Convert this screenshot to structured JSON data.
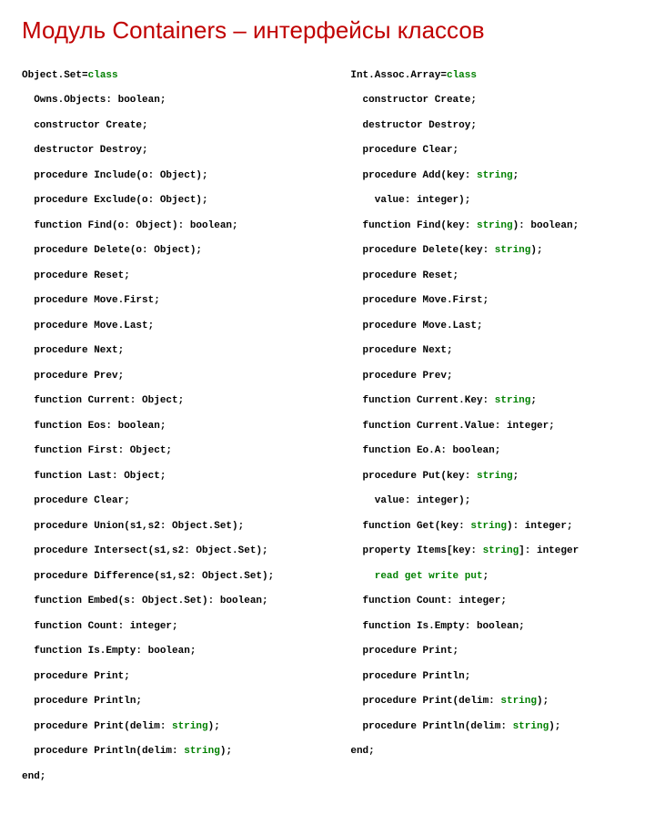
{
  "title": "Модуль Containers – интерфейсы классов",
  "left": {
    "l0a": "Object.Set=",
    "l0b": "class",
    "l1a": "Owns.Objects: ",
    "l1b": "boolean;",
    "l2a": "constructor",
    "l2b": " Create;",
    "l3a": "destructor",
    "l3b": " Destroy;",
    "l4a": "procedure",
    "l4b": " Include(o: Object);",
    "l5a": "procedure",
    "l5b": " Exclude(o: Object);",
    "l6a": "function",
    "l6b": " Find(o: Object): boolean;",
    "l7a": "procedure",
    "l7b": " Delete(o: Object);",
    "l8a": "procedure",
    "l8b": " Reset;",
    "l9a": "procedure",
    "l9b": " Move.First;",
    "l10a": "procedure",
    "l10b": " Move.Last;",
    "l11a": "procedure",
    "l11b": " Next;",
    "l12a": "procedure",
    "l12b": " Prev;",
    "l13a": "function",
    "l13b": " Current: Object;",
    "l14a": "function",
    "l14b": " Eos: boolean;",
    "l15a": "function",
    "l15b": " First: Object;",
    "l16a": "function",
    "l16b": " Last: Object;",
    "l17a": "procedure",
    "l17b": " Clear;",
    "l18a": "procedure",
    "l18b": " Union(s1,s2: Object.Set);",
    "l19a": "procedure",
    "l19b": " Intersect(s1,s2: Object.Set);",
    "l20a": "procedure",
    "l20b": " Difference(s1,s2: Object.Set);",
    "l21a": "function",
    "l21b": " Embed(s: Object.Set): boolean;",
    "l22a": "function",
    "l22b": " Count: integer;",
    "l23a": "function",
    "l23b": " Is.Empty: boolean;",
    "l24a": "procedure",
    "l24b": " Print;",
    "l25a": "procedure",
    "l25b": " Println;",
    "l26a": "procedure",
    "l26b": " Print(delim: ",
    "l26c": "string",
    "l26d": ");",
    "l27a": "procedure",
    "l27b": " Println(delim: ",
    "l27c": "string",
    "l27d": ");",
    "l28": "end;"
  },
  "right": {
    "r0a": "Int.Assoc.Array=",
    "r0b": "class",
    "r1a": "constructor",
    "r1b": " Create;",
    "r2a": "destructor",
    "r2b": " Destroy;",
    "r3a": "procedure",
    "r3b": " Clear;",
    "r4a": "procedure",
    "r4b": " Add(key: ",
    "r4c": "string",
    "r4d": ";",
    "r4e": "value: integer);",
    "r5a": "function",
    "r5b": " Find(key: ",
    "r5c": "string",
    "r5d": "): boolean;",
    "r6a": "procedure",
    "r6b": " Delete(key: ",
    "r6c": "string",
    "r6d": ");",
    "r7a": "procedure",
    "r7b": " Reset;",
    "r8a": "procedure",
    "r8b": " Move.First;",
    "r9a": "procedure",
    "r9b": " Move.Last;",
    "r10a": "procedure",
    "r10b": " Next;",
    "r11a": "procedure",
    "r11b": " Prev;",
    "r12a": "function",
    "r12b": " Current.Key: ",
    "r12c": "string",
    "r12d": ";",
    "r13a": "function",
    "r13b": " Current.Value: integer;",
    "r14a": "function",
    "r14b": " Eo.A: boolean;",
    "r15a": "procedure",
    "r15b": " Put(key: ",
    "r15c": "string",
    "r15d": ";",
    "r15e": "value: integer);",
    "r16a": "function",
    "r16b": " Get(key: ",
    "r16c": "string",
    "r16d": "): integer;",
    "r17a": "property",
    "r17b": " Items[key: ",
    "r17c": "string",
    "r17d": "]: integer",
    "r17e": "read get write put",
    "r17f": ";",
    "r18a": "function",
    "r18b": " Count: integer;",
    "r19a": "function",
    "r19b": " Is.Empty: boolean;",
    "r20a": "procedure",
    "r20b": " Print;",
    "r21a": "procedure",
    "r21b": " Println;",
    "r22a": "procedure",
    "r22b": " Print(delim: ",
    "r22c": "string",
    "r22d": ");",
    "r23a": "procedure",
    "r23b": " Println(delim: ",
    "r23c": "string",
    "r23d": ");",
    "r24": "end;"
  }
}
